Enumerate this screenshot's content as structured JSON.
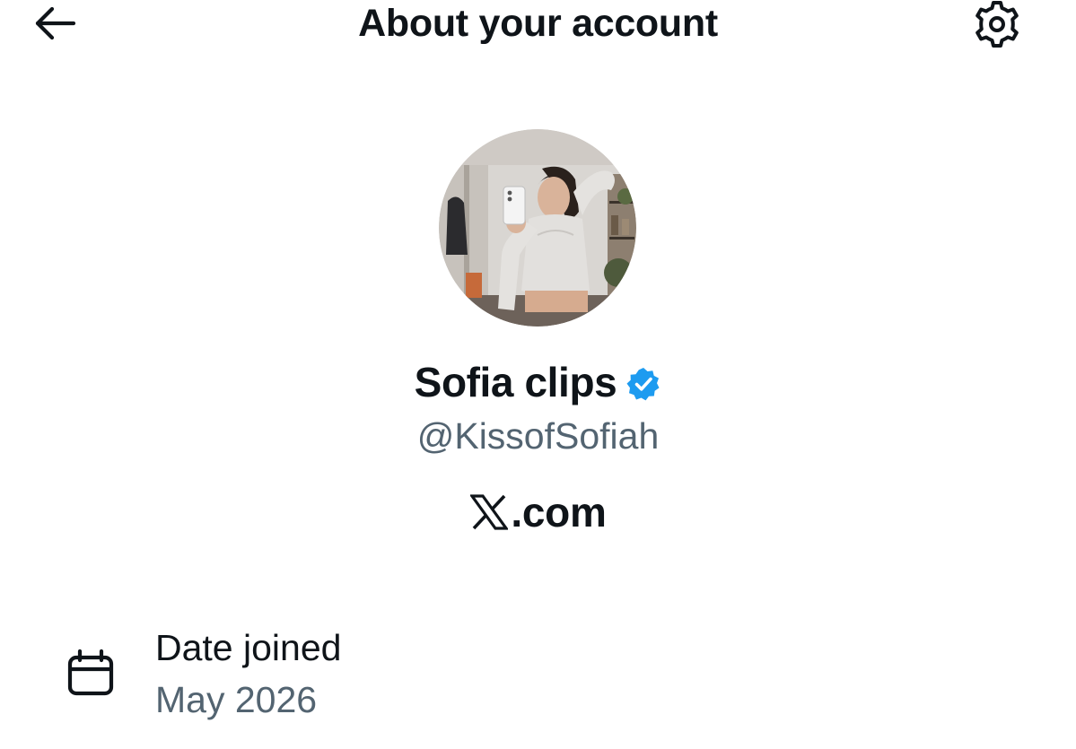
{
  "header": {
    "title": "About your account",
    "back_icon": "arrow-left-icon",
    "settings_icon": "gear-icon"
  },
  "profile": {
    "display_name": "Sofia clips",
    "verified_badge_icon": "verified-badge-icon",
    "handle": "@KissofSofiah",
    "domain_logo_icon": "x-logo-icon",
    "domain_text": ".com"
  },
  "details": {
    "date_joined_icon": "calendar-icon",
    "date_joined_label": "Date joined",
    "date_joined_value": "May 2026"
  },
  "colors": {
    "text_primary": "#0f1419",
    "text_secondary": "#536471",
    "verified_blue": "#1d9bf0",
    "background": "#ffffff"
  }
}
